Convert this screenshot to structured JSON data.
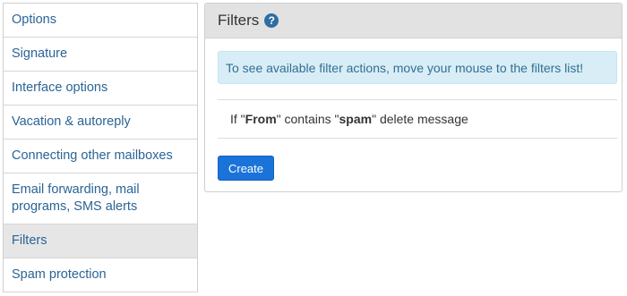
{
  "sidebar": {
    "items": [
      {
        "label": "Options"
      },
      {
        "label": "Signature"
      },
      {
        "label": "Interface options"
      },
      {
        "label": "Vacation & autoreply"
      },
      {
        "label": "Connecting other mailboxes"
      },
      {
        "label": "Email forwarding, mail programs, SMS alerts"
      },
      {
        "label": "Filters",
        "active": true
      },
      {
        "label": "Spam protection"
      }
    ]
  },
  "panel": {
    "title": "Filters",
    "help_icon": "question-circle-icon",
    "info_text": "To see available filter actions, move your mouse to the filters list!",
    "rules": [
      {
        "prefix": "If \"",
        "field": "From",
        "middle": "\" contains \"",
        "value": "spam",
        "suffix": "\" delete message"
      }
    ],
    "create_label": "Create"
  },
  "colors": {
    "link": "#2a6496",
    "active_bg": "#e6e6e6",
    "header_bg": "#e2e2e2",
    "info_bg": "#d9edf7",
    "info_text": "#31708f",
    "button_bg": "#1a73d9"
  }
}
